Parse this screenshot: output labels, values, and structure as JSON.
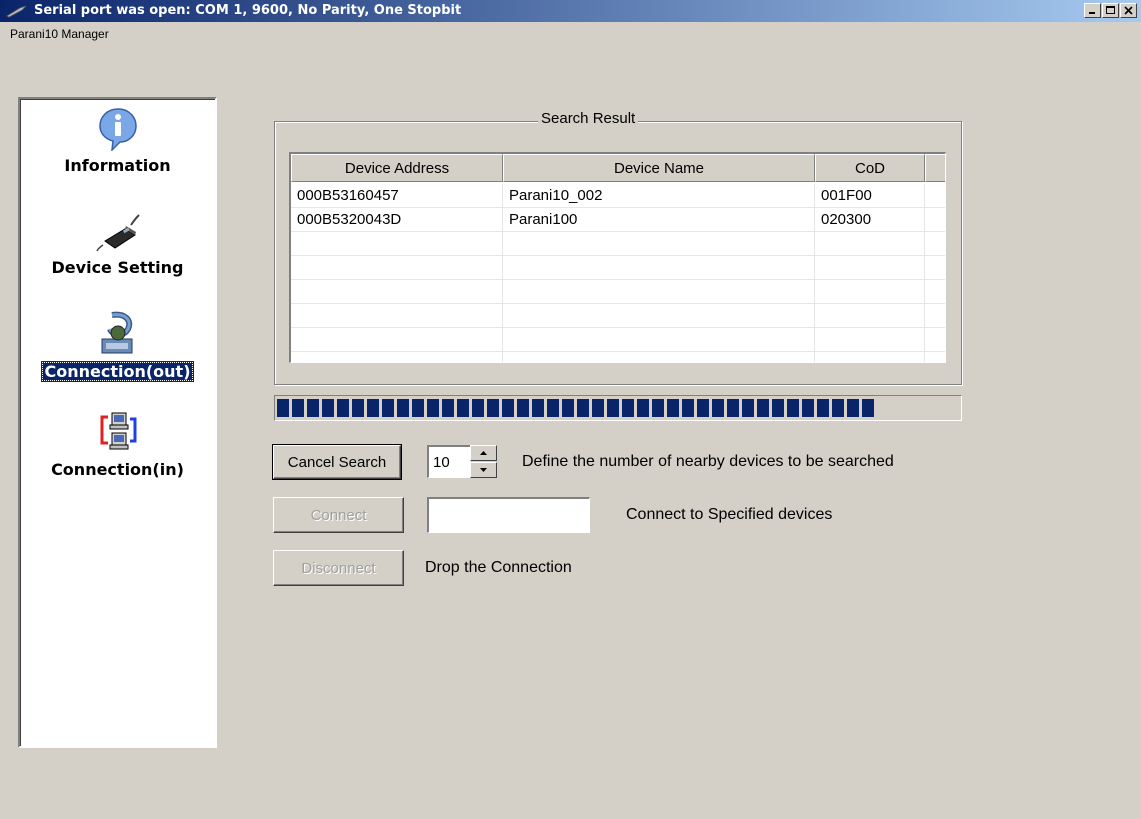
{
  "window": {
    "title": "Serial port was open: COM 1, 9600, No Parity, One Stopbit",
    "app_name": "Parani10 Manager"
  },
  "sidebar": {
    "items": [
      {
        "label": "Information",
        "icon": "info-icon",
        "active": false
      },
      {
        "label": "Device Setting",
        "icon": "device-icon",
        "active": false
      },
      {
        "label": "Connection(out)",
        "icon": "connection-out-icon",
        "active": true
      },
      {
        "label": "Connection(in)",
        "icon": "connection-in-icon",
        "active": false
      }
    ]
  },
  "search_result": {
    "title": "Search Result",
    "columns": [
      "Device Address",
      "Device Name",
      "CoD"
    ],
    "rows": [
      [
        "000B53160457",
        "Parani10_002",
        "001F00"
      ],
      [
        "000B5320043D",
        "Parani100",
        "020300"
      ]
    ]
  },
  "progress": {
    "value": 0.88
  },
  "controls": {
    "cancel_search_label": "Cancel Search",
    "device_count_value": "10",
    "device_count_desc": "Define the number of nearby devices to be searched",
    "connect_label": "Connect",
    "connect_input_value": "",
    "connect_desc": "Connect to Specified devices",
    "disconnect_label": "Disconnect",
    "disconnect_desc": "Drop the Connection"
  },
  "colors": {
    "titlebar": "#0a246a",
    "progress": "#0a246a",
    "window_bg": "#d4d0c8"
  }
}
